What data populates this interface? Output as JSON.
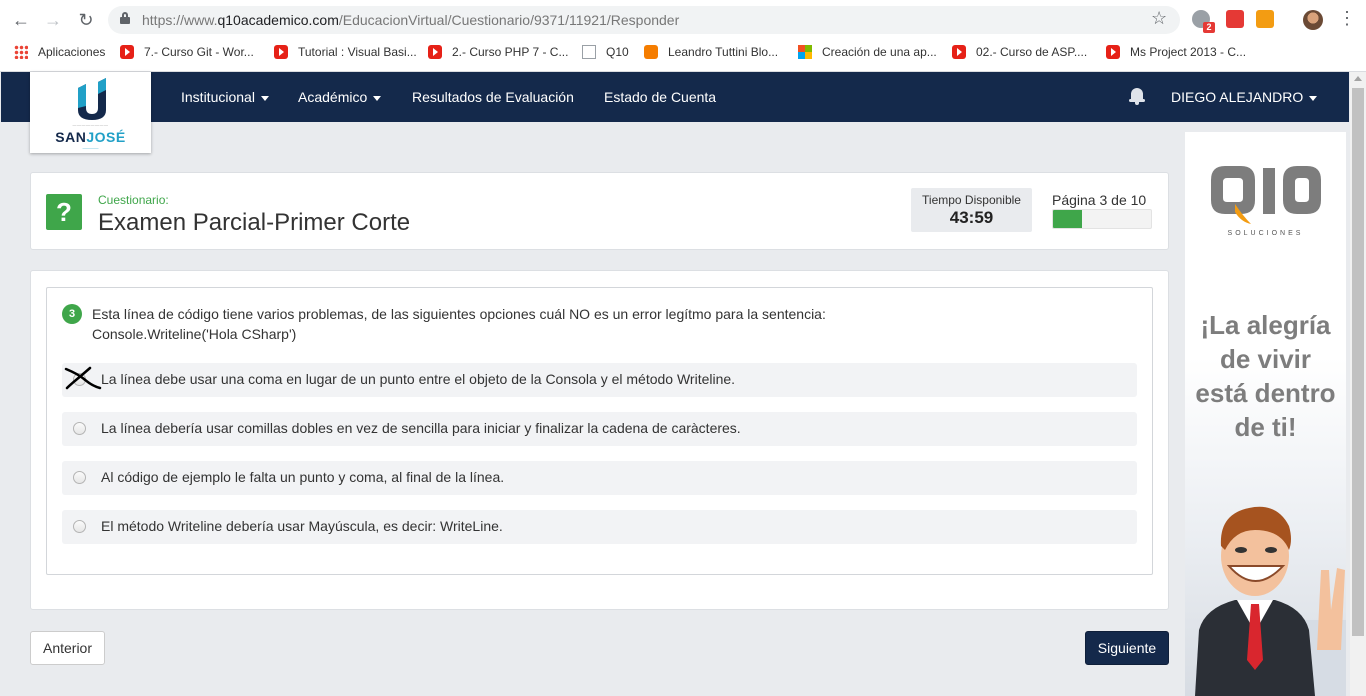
{
  "browser": {
    "url_prefix": "https://www.",
    "url_host": "q10academico.com",
    "url_path": "/EducacionVirtual/Cuestionario/9371/11921/Responder",
    "extension_badge": "2",
    "bookmarks": [
      {
        "label": "Aplicaciones",
        "icon": "apps-icon"
      },
      {
        "label": "7.- Curso Git - Wor...",
        "icon": "youtube-icon"
      },
      {
        "label": "Tutorial : Visual Basi...",
        "icon": "youtube-icon"
      },
      {
        "label": "2.- Curso PHP 7 - C...",
        "icon": "youtube-icon"
      },
      {
        "label": "Q10",
        "icon": "document-icon"
      },
      {
        "label": "Leandro Tuttini Blo...",
        "icon": "blogger-icon"
      },
      {
        "label": "Creación de una ap...",
        "icon": "microsoft-icon"
      },
      {
        "label": "02.- Curso de ASP....",
        "icon": "youtube-icon"
      },
      {
        "label": "Ms Project 2013 - C...",
        "icon": "youtube-icon"
      }
    ]
  },
  "navbar": {
    "items": [
      "Institucional",
      "Académico",
      "Resultados de Evaluación",
      "Estado de Cuenta"
    ],
    "user": "DIEGO ALEJANDRO",
    "logo": {
      "name_a": "SAN",
      "name_b": "JOSÉ"
    }
  },
  "quiz": {
    "label": "Cuestionario:",
    "title": "Examen Parcial-Primer Corte",
    "timer_label": "Tiempo Disponible",
    "timer_value": "43:59",
    "page_label": "Página 3 de 10",
    "progress": 0.3
  },
  "question": {
    "number": "3",
    "line1": "Esta línea de código tiene varios problemas, de las siguientes opciones cuál NO es un error legítmo para la sentencia:",
    "line2": "Console.Writeline('Hola CSharp')",
    "options": [
      "La línea debe usar una coma en lugar de un punto entre el objeto de la Consola y el método Writeline.",
      "La línea debería usar comillas dobles en vez de sencilla para iniciar y finalizar la cadena de caràcteres.",
      "Al código de ejemplo le falta un punto y coma, al final de la línea.",
      "El método Writeline debería usar Mayúscula, es decir: WriteLine."
    ]
  },
  "buttons": {
    "prev": "Anterior",
    "next": "Siguiente"
  },
  "ad": {
    "brand": "Q10",
    "sub": "SOLUCIONES",
    "headline": "¡La alegría\nde vivir\nestá dentro\nde ti!",
    "brand_color": "#7d7d7d",
    "accent_color": "#f39c12"
  },
  "colors": {
    "navbar": "#14294b",
    "accent": "#3fa64a"
  }
}
